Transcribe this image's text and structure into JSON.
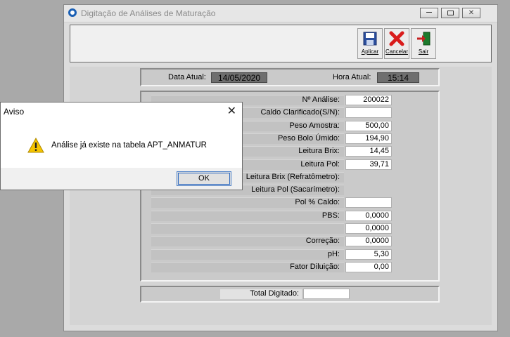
{
  "window": {
    "title": "Digitação de Análises de Maturação"
  },
  "titlebar_buttons": [
    "minimize-icon",
    "maximize-icon",
    "close-icon"
  ],
  "toolbar": {
    "apply_label": "Aplicar",
    "cancel_label": "Cancelar",
    "exit_label": "Sair"
  },
  "header": {
    "date_label": "Data Atual:",
    "date_value": "14/05/2020",
    "time_label": "Hora Atual:",
    "time_value": "15:14"
  },
  "form": {
    "rows": [
      {
        "label": "Nº Análise:",
        "value": "200022",
        "field": true
      },
      {
        "label": "Caldo Clarificado(S/N):",
        "value": "",
        "field": true
      },
      {
        "label": "Peso Amostra:",
        "value": "500,00",
        "field": true
      },
      {
        "label": "Peso Bolo Úmido:",
        "value": "194,90",
        "field": true
      },
      {
        "label": "Leitura Brix:",
        "value": "14,45",
        "field": true
      },
      {
        "label": "Leitura Pol:",
        "value": "39,71",
        "field": true
      },
      {
        "label": "Leitura Brix (Refratômetro):",
        "value": "",
        "field": false
      },
      {
        "label": "Leitura Pol (Sacarímetro):",
        "value": "",
        "field": false
      },
      {
        "label": "Pol % Caldo:",
        "value": "",
        "field": true
      },
      {
        "label": "PBS:",
        "value": "0,0000",
        "field": true
      },
      {
        "label": "",
        "value": "0,0000",
        "field": true
      },
      {
        "label": "Correção:",
        "value": "0,0000",
        "field": true
      },
      {
        "label": "pH:",
        "value": "5,30",
        "field": true
      },
      {
        "label": "Fator Diluição:",
        "value": "0,00",
        "field": true
      }
    ]
  },
  "footer": {
    "total_label": "Total Digitado:",
    "total_value": ""
  },
  "dialog": {
    "title": "Aviso",
    "message": "Análise já existe na tabela APT_ANMATUR",
    "ok_label": "OK",
    "icon": "warning-icon"
  }
}
